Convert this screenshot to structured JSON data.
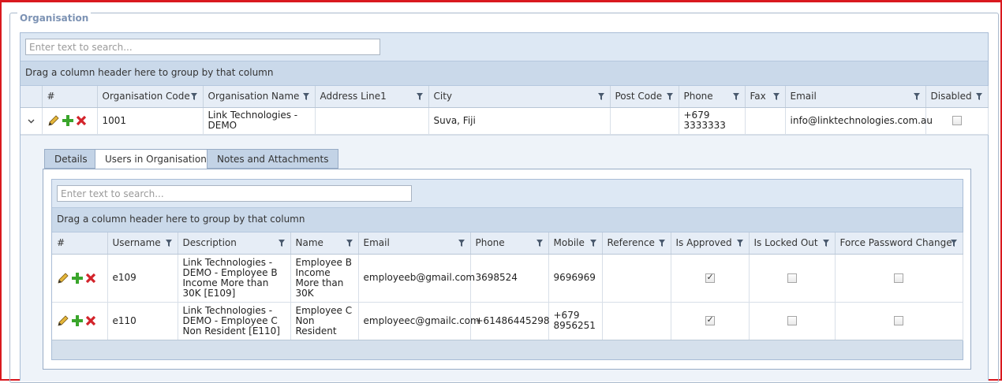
{
  "fieldset": {
    "legend": "Organisation"
  },
  "outer_grid": {
    "search_placeholder": "Enter text to search...",
    "group_hint": "Drag a column header here to group by that column",
    "columns": [
      "#",
      "Organisation Code",
      "Organisation Name",
      "Address Line1",
      "City",
      "Post Code",
      "Phone",
      "Fax",
      "Email",
      "Disabled"
    ],
    "rows": [
      {
        "code": "1001",
        "name": "Link Technologies - DEMO",
        "address": "",
        "city": "Suva, Fiji",
        "post_code": "",
        "phone": "+679 3333333",
        "fax": "",
        "email": "info@linktechnologies.com.au",
        "disabled": false
      }
    ]
  },
  "detail": {
    "tabs": [
      {
        "label": "Details",
        "active": false
      },
      {
        "label": "Users in Organisation",
        "active": true
      },
      {
        "label": "Notes and Attachments",
        "active": false
      }
    ],
    "inner_grid": {
      "search_placeholder": "Enter text to search...",
      "group_hint": "Drag a column header here to group by that column",
      "columns": [
        "#",
        "Username",
        "Description",
        "Name",
        "Email",
        "Phone",
        "Mobile",
        "Reference",
        "Is Approved",
        "Is Locked Out",
        "Force Password Change"
      ],
      "rows": [
        {
          "username": "e109",
          "description": "Link Technologies - DEMO - Employee B Income More than 30K [E109]",
          "name": "Employee B Income More than 30K",
          "email": "employeeb@gmail.com",
          "phone": "3698524",
          "mobile": "9696969",
          "reference": "",
          "is_approved": true,
          "is_locked_out": false,
          "force_password_change": false
        },
        {
          "username": "e110",
          "description": "Link Technologies - DEMO - Employee C Non Resident [E110]",
          "name": "Employee C Non Resident",
          "email": "employeec@gmailc.com",
          "phone": "+61486445298",
          "mobile": "+679 8956251",
          "reference": "",
          "is_approved": true,
          "is_locked_out": false,
          "force_password_change": false
        }
      ]
    }
  },
  "icons": {
    "edit": "pencil-icon",
    "add": "plus-icon",
    "delete": "x-icon",
    "filter": "funnel-icon",
    "expand": "chevron-down-icon"
  },
  "colors": {
    "frame": "#d9191f",
    "header_bg": "#e6edf6",
    "group_bar": "#cad9ea",
    "add_green": "#3aa52b",
    "delete_red": "#d3232a"
  }
}
